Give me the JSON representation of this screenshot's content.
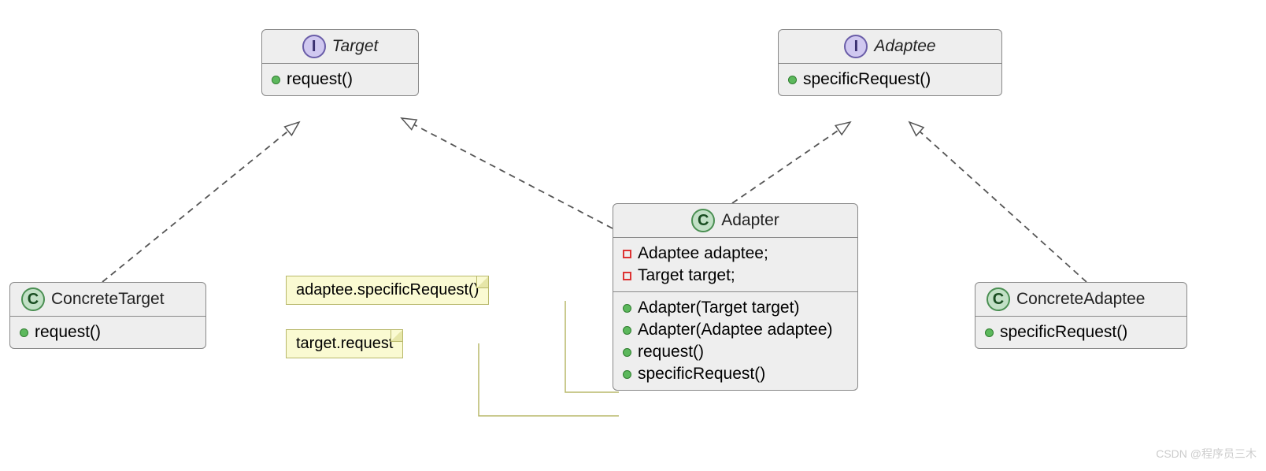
{
  "badges": {
    "I": "I",
    "C": "C"
  },
  "target": {
    "name": "Target",
    "method": "request()"
  },
  "adaptee": {
    "name": "Adaptee",
    "method": "specificRequest()"
  },
  "concreteTarget": {
    "name": "ConcreteTarget",
    "method": "request()"
  },
  "concreteAdaptee": {
    "name": "ConcreteAdaptee",
    "method": "specificRequest()"
  },
  "adapter": {
    "name": "Adapter",
    "fields": {
      "adaptee": "Adaptee adaptee;",
      "target": "Target target;"
    },
    "methods": {
      "ctorTarget": "Adapter(Target target)",
      "ctorAdaptee": "Adapter(Adaptee adaptee)",
      "request": "request()",
      "specific": "specificRequest()"
    }
  },
  "notes": {
    "note1": "adaptee.specificRequest()",
    "note2": "target.request"
  },
  "watermark": "CSDN @程序员三木"
}
